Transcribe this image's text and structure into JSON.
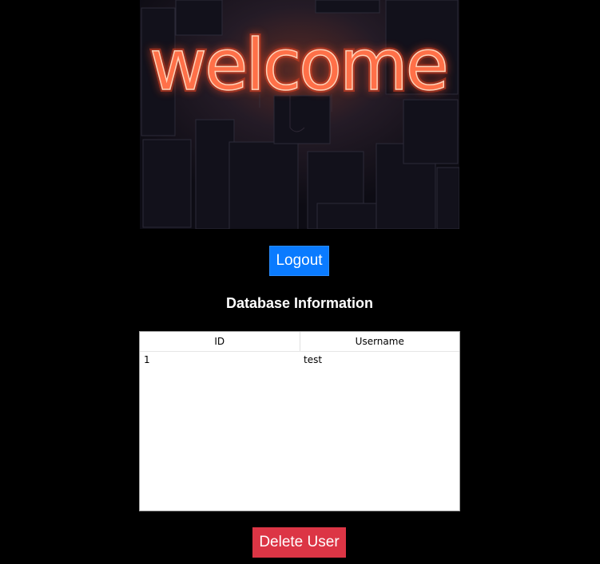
{
  "banner": {
    "text": "welcome",
    "glow_color": "#ff5a36",
    "core_color": "#ffc9a8"
  },
  "logout_label": "Logout",
  "section_title": "Database Information",
  "table": {
    "headers": [
      "ID",
      "Username"
    ],
    "rows": [
      [
        "1",
        "test"
      ]
    ]
  },
  "delete_label": "Delete User",
  "colors": {
    "background": "#000000",
    "primary_button": "#0a7bff",
    "danger_button": "#dc3545"
  }
}
